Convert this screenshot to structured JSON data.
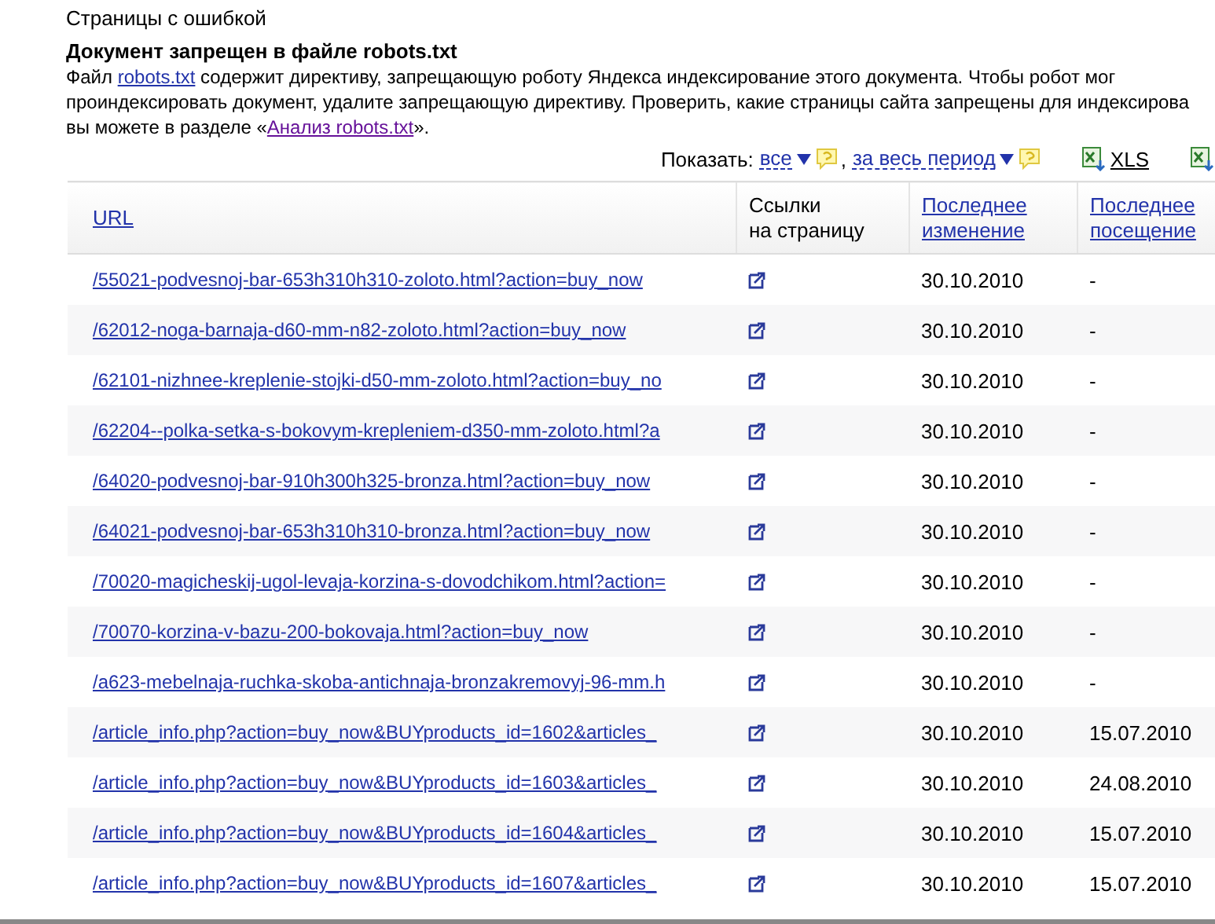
{
  "section_title": "Страницы с ошибкой",
  "error": {
    "title": "Документ запрещен в файле robots.txt",
    "text_parts": [
      {
        "kind": "text",
        "text": "Файл "
      },
      {
        "kind": "link",
        "text": "robots.txt"
      },
      {
        "kind": "text",
        "text": " содержит директиву, запрещающую роботу Яндекса индексирование этого документа. Чтобы робот мог"
      },
      {
        "kind": "break"
      },
      {
        "kind": "text",
        "text": "проиндексировать документ, удалите запрещающую директиву. Проверить, какие страницы сайта запрещены для индексирова"
      },
      {
        "kind": "break"
      },
      {
        "kind": "text",
        "text": "вы можете в разделе «"
      },
      {
        "kind": "visited_link",
        "text": "Анализ robots.txt"
      },
      {
        "kind": "text",
        "text": "»."
      }
    ]
  },
  "filters": {
    "label": "Показать:",
    "items": [
      {
        "value": "все"
      },
      {
        "value": "за весь период",
        "separator": ","
      }
    ]
  },
  "exports": [
    {
      "kind": "labeled",
      "label": "XLS"
    },
    {
      "kind": "icon_only"
    }
  ],
  "table": {
    "columns": [
      {
        "label": "URL",
        "kind": "link"
      },
      {
        "label": "Ссылки на страницу",
        "kind": "text"
      },
      {
        "label": "Последнее изменение",
        "kind": "link"
      },
      {
        "label": "Последнее посещение",
        "kind": "link"
      }
    ],
    "rows": [
      {
        "url": "/55021-podvesnoj-bar-653h310h310-zoloto.html?action=buy_now",
        "changed": "30.10.2010",
        "visited": "-"
      },
      {
        "url": "/62012-noga-barnaja-d60-mm-n82-zoloto.html?action=buy_now",
        "changed": "30.10.2010",
        "visited": "-"
      },
      {
        "url": "/62101-nizhnee-kreplenie-stojki-d50-mm-zoloto.html?action=buy_no",
        "changed": "30.10.2010",
        "visited": "-"
      },
      {
        "url": "/62204--polka-setka-s-bokovym-krepleniem-d350-mm-zoloto.html?a",
        "changed": "30.10.2010",
        "visited": "-"
      },
      {
        "url": "/64020-podvesnoj-bar-910h300h325-bronza.html?action=buy_now",
        "changed": "30.10.2010",
        "visited": "-"
      },
      {
        "url": "/64021-podvesnoj-bar-653h310h310-bronza.html?action=buy_now",
        "changed": "30.10.2010",
        "visited": "-"
      },
      {
        "url": "/70020-magicheskij-ugol-levaja-korzina-s-dovodchikom.html?action=",
        "changed": "30.10.2010",
        "visited": "-"
      },
      {
        "url": "/70070-korzina-v-bazu-200-bokovaja.html?action=buy_now",
        "changed": "30.10.2010",
        "visited": "-"
      },
      {
        "url": "/a623-mebelnaja-ruchka-skoba-antichnaja-bronzakremovyj-96-mm.h",
        "changed": "30.10.2010",
        "visited": "-"
      },
      {
        "url": "/article_info.php?action=buy_now&BUYproducts_id=1602&articles_",
        "changed": "30.10.2010",
        "visited": "15.07.2010"
      },
      {
        "url": "/article_info.php?action=buy_now&BUYproducts_id=1603&articles_",
        "changed": "30.10.2010",
        "visited": "24.08.2010"
      },
      {
        "url": "/article_info.php?action=buy_now&BUYproducts_id=1604&articles_",
        "changed": "30.10.2010",
        "visited": "15.07.2010"
      },
      {
        "url": "/article_info.php?action=buy_now&BUYproducts_id=1607&articles_",
        "changed": "30.10.2010",
        "visited": "15.07.2010"
      }
    ]
  }
}
